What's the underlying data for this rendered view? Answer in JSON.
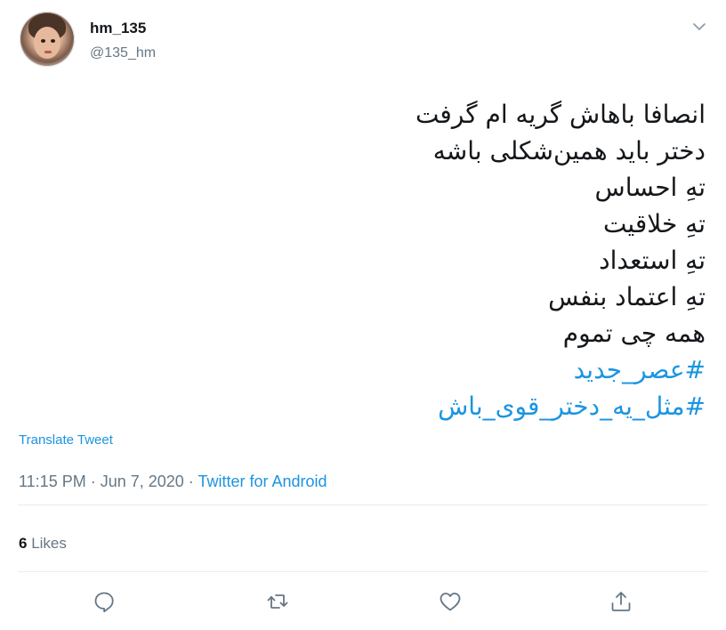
{
  "user": {
    "display_name": "hm_135",
    "handle": "@135_hm"
  },
  "tweet": {
    "lines": [
      "انصافا باهاش گریه ام گرفت",
      "دختر باید همین‌شکلی باشه",
      "تهِ احساس",
      "تهِ خلاقیت",
      "تهِ استعداد",
      "تهِ اعتماد بنفس",
      "همه چی تموم"
    ],
    "hashtags": [
      "#عصر_جدید",
      "#مثل_یه_دختر_قوی_باش"
    ]
  },
  "translate_label": "Translate Tweet",
  "meta": {
    "time": "11:15 PM",
    "separator": " · ",
    "date": "Jun 7, 2020",
    "source": "Twitter for Android"
  },
  "stats": {
    "likes_count": "6",
    "likes_label": "Likes"
  },
  "icons": {
    "more": "chevron-down-icon",
    "reply": "reply-icon",
    "retweet": "retweet-icon",
    "like": "heart-icon",
    "share": "share-icon"
  },
  "colors": {
    "link": "#1b95e0",
    "muted": "#657786",
    "text": "#14171a",
    "divider": "#e6ecf0"
  }
}
